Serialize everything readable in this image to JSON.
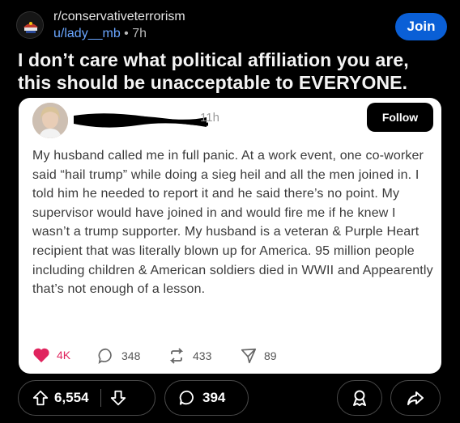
{
  "post": {
    "subreddit": "r/conservativeterrorism",
    "username": "u/lady__mb",
    "separator": "•",
    "age": "7h",
    "join_label": "Join",
    "title": "I don’t care what political affiliation you are, this should be unacceptable to EVERYONE."
  },
  "embedded": {
    "time": "11h",
    "follow_label": "Follow",
    "text": "My husband called me in full panic. At a work event, one co-worker said “hail trump” while doing a sieg heil and all the men joined in. I told him he needed to report it and he said there’s no point. My supervisor would have joined in and would fire me if he knew I wasn’t a trump supporter. My husband is a veteran & Purple Heart recipient that was literally blown up for America. 95 million people including children & American soldiers died in WWII and Appearently that’s not enough of a lesson.",
    "likes": "4K",
    "replies": "348",
    "reposts": "433",
    "shares": "89",
    "like_color": "#e0245e"
  },
  "actions": {
    "upvotes": "6,554",
    "comments": "394",
    "icons": [
      "upvote-icon",
      "downvote-icon",
      "comment-icon",
      "award-icon",
      "share-icon"
    ]
  },
  "colors": {
    "accent": "#0a5fd6",
    "link": "#6aa6ff",
    "background": "#000000"
  }
}
